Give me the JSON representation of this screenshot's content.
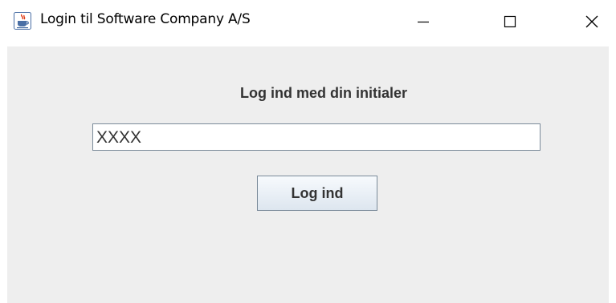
{
  "window": {
    "title": "Login til Software Company A/S",
    "app_icon": "java-cup-icon",
    "controls": {
      "minimize_icon": "minimize-icon",
      "maximize_icon": "maximize-icon",
      "close_icon": "close-icon"
    }
  },
  "form": {
    "prompt": "Log ind med din initialer",
    "initials_value": "XXXX",
    "login_button_label": "Log ind"
  },
  "colors": {
    "content_background": "#eeeeee",
    "title_bar_background": "#ffffff",
    "text": "#333333",
    "field_border": "#7a8a99"
  }
}
